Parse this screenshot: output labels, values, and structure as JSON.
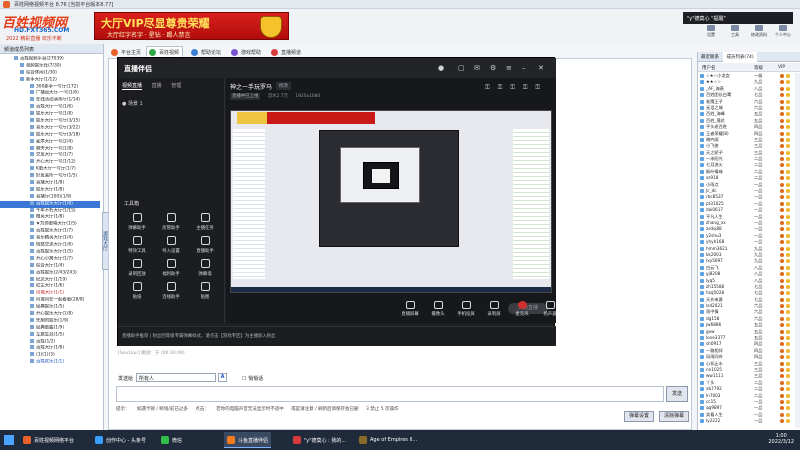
{
  "window": {
    "title": "百姓网络视频平台 8.76 [当前平台版本8.77]"
  },
  "banner": {
    "logo_main": "百姓视频网",
    "logo_url": "HD.FXT365.COM",
    "logo_slogan": "2022 精彩直播 欢乐不断",
    "vip_line1": "大厅VIP尽显尊贵荣耀",
    "vip_line2": "大厅红字名字 · 星钻 · 踢人禁言"
  },
  "tooltip": "\"y\"德莫心 \"提醒\"",
  "top_icons": [
    "设置",
    "工具",
    "修改资料",
    "个人中心"
  ],
  "left_panel": {
    "header": "频道成员列表",
    "tree": [
      {
        "label": "百姓视频平台(27039)",
        "cls": ""
      },
      {
        "label": "视频娱乐社(7/30)",
        "cls": ""
      },
      {
        "label": "综合休闲(1/30)",
        "cls": ""
      },
      {
        "label": "新手大厅(1/12)",
        "cls": ""
      },
      {
        "label": "300新手一号厅(172)",
        "cls": ""
      },
      {
        "label": "广播台大厅-一号(1/6)",
        "cls": ""
      },
      {
        "label": "在线活动演示厅(1/14)",
        "cls": ""
      },
      {
        "label": "百姓大厅一号(1/6)",
        "cls": ""
      },
      {
        "label": "娱乐大厅一号(1/8)",
        "cls": ""
      },
      {
        "label": "娱乐大厅一号厅(3/15)",
        "cls": ""
      },
      {
        "label": "音乐大厅一号厅(3/22)",
        "cls": ""
      },
      {
        "label": "娱乐大厅一号厅(3/18)",
        "cls": ""
      },
      {
        "label": "麦序大厅一号(2/4)",
        "cls": ""
      },
      {
        "label": "聊天大厅一号(1/8)",
        "cls": ""
      },
      {
        "label": "交友大厅一号(1/7)",
        "cls": ""
      },
      {
        "label": "开心大厅一号(1/12)",
        "cls": ""
      },
      {
        "label": "K歌大厅一号厅(1/7)",
        "cls": ""
      },
      {
        "label": "好友会所一号厅(1/5)",
        "cls": ""
      },
      {
        "label": "直播大厅(1/8)",
        "cls": ""
      },
      {
        "label": "娱乐大厅(1/8)",
        "cls": ""
      },
      {
        "label": "直播厅(100)(1/9)",
        "cls": ""
      },
      {
        "label": "百姓娱乐大厅(1/6)",
        "cls": "sel"
      },
      {
        "label": "千年不朽大厅(1/15)",
        "cls": ""
      },
      {
        "label": "精英大厅(1/8)",
        "cls": ""
      },
      {
        "label": "★为你歌唱大厅(1/5)",
        "cls": ""
      },
      {
        "label": "百姓娱乐大厅(1/7)",
        "cls": ""
      },
      {
        "label": "音乐精英大厅(1/4)",
        "cls": ""
      },
      {
        "label": "情感交流大厅(1/6)",
        "cls": ""
      },
      {
        "label": "百姓娱乐大厅(1/5)",
        "cls": ""
      },
      {
        "label": "开心小窝大厅(1/7)",
        "cls": ""
      },
      {
        "label": "综合大厅(1/4)",
        "cls": ""
      },
      {
        "label": "百姓娱乐(2/43/243)",
        "cls": ""
      },
      {
        "label": "纪念大厅(1/19)",
        "cls": ""
      },
      {
        "label": "红尘大厅(1/6)",
        "cls": ""
      },
      {
        "label": "同城大厅(1/1)",
        "cls": "red"
      },
      {
        "label": "同城同在一起看看(28/8)",
        "cls": ""
      },
      {
        "label": "经典娱乐(1/5)",
        "cls": ""
      },
      {
        "label": "开心娱乐大厅(1/8)",
        "cls": ""
      },
      {
        "label": "先期的娱乐(1/9)",
        "cls": ""
      },
      {
        "label": "经典歌曲(1/9)",
        "cls": ""
      },
      {
        "label": "军旅生涯(1/5)",
        "cls": ""
      },
      {
        "label": "百姓(1/2)",
        "cls": ""
      },
      {
        "label": "百姓大厅(1/6)",
        "cls": ""
      },
      {
        "label": "(1)(1)(3)",
        "cls": ""
      },
      {
        "label": "百姓欢乐(1/1)",
        "cls": "blu"
      }
    ],
    "vertical_tab": "游戏大厅"
  },
  "nav_tabs": [
    "平台主页",
    "百姓视频",
    "帮助论坛",
    "游戏帮助",
    "直播频道"
  ],
  "stream_app": {
    "logo": "直播伴侣",
    "tabs": [
      "视频直播",
      "直播",
      "管理"
    ],
    "scene": "● 场景 1",
    "room_title": "神之一手玩罗马",
    "room_badge": "修改",
    "room_sub": [
      "直播中已上线",
      "流水2.7万",
      "1920x1080"
    ],
    "tools_header": "工具箱",
    "tools": [
      "弹幕助手",
      "房管助手",
      "主播任务",
      "特效工具",
      "导入设置",
      "直播助手",
      "录制回放",
      "福利助手",
      "弹幕墙",
      "贴纸",
      "连线助手",
      "贴图"
    ],
    "bottom_tools": [
      "直播屏幕",
      "摄像头",
      "手机投屏",
      "录制屏",
      "麦克风",
      "扬声器"
    ],
    "start_live": "开始直播",
    "footer_notice": "直播助手推荐 | 粉丝团等级专属弹幕样式，请点击【游戏专区】为主播加入粉丝"
  },
  "chat": {
    "message_meta": "[Sou1kur] 踢进：于 (00:30:49)",
    "send_to_label": "发送给",
    "send_to_value": "所有人",
    "font_btn": "A",
    "private_chk": "悄悄话",
    "send_btn": "发送",
    "notice": [
      "提示：",
      "如遇卡顿 / 断线/前已过多",
      "点击：",
      "若你的电脑声音无法显示时不适中",
      "或是请注意 / 刷新后请保存会已删",
      "3 禁止 5 次操作"
    ],
    "btn_settings": "弹幕设置",
    "btn_clear": "清除弹幕"
  },
  "right_panel": {
    "tabs": [
      "最近联系",
      "成员列表(74)"
    ],
    "header": [
      "用户名",
      "等级",
      "VIP"
    ],
    "users": [
      {
        "name": "☆★☆小龙女",
        "rank": "一级"
      },
      {
        "name": "★★☆☆",
        "rank": "九品"
      },
      {
        "name": "_AF_海燕",
        "rank": "八品"
      },
      {
        "name": "百姓团长白鹭",
        "rank": "七品"
      },
      {
        "name": "老鹰王子",
        "rank": "六品"
      },
      {
        "name": "无泪之城",
        "rank": "六品"
      },
      {
        "name": "百姓_海峰",
        "rank": "五品"
      },
      {
        "name": "百姓_落花",
        "rank": "五品"
      },
      {
        "name": "平头老百姓",
        "rank": "四品"
      },
      {
        "name": "王者荣耀(8)",
        "rank": "四品"
      },
      {
        "name": "晓吟阁",
        "rank": "三品"
      },
      {
        "name": "小飞侠",
        "rank": "三品"
      },
      {
        "name": "天之骄子",
        "rank": "三品"
      },
      {
        "name": "一米阳光",
        "rank": "二品"
      },
      {
        "name": "七月流火",
        "rank": "二品"
      },
      {
        "name": "枫叶情缘",
        "rank": "二品"
      },
      {
        "name": "ss918",
        "rank": "二品"
      },
      {
        "name": "小雨点",
        "rank": "一品"
      },
      {
        "name": "Jc_dc",
        "rank": "一品"
      },
      {
        "name": "rbc8537",
        "rank": "一品"
      },
      {
        "name": "pt31025",
        "rank": "一品"
      },
      {
        "name": "dai0617",
        "rank": "一品"
      },
      {
        "name": "平凡人生",
        "rank": "一品"
      },
      {
        "name": "zhang_xx",
        "rank": "一品"
      },
      {
        "name": "zsdsj88",
        "rank": "一品"
      },
      {
        "name": "y2shu3",
        "rank": "一品"
      },
      {
        "name": "yhyh168",
        "rank": "一品"
      },
      {
        "name": "hmm3621",
        "rank": "九品"
      },
      {
        "name": "kk2003",
        "rank": "九品"
      },
      {
        "name": "Ixy5697",
        "rank": "九品"
      },
      {
        "name": "白云飞",
        "rank": "八品"
      },
      {
        "name": "yj8208",
        "rank": "八品"
      },
      {
        "name": "lyq5",
        "rank": "八品"
      },
      {
        "name": "zh15588",
        "rank": "七品"
      },
      {
        "name": "hzq5028",
        "rank": "七品"
      },
      {
        "name": "天外来客",
        "rank": "七品"
      },
      {
        "name": "lsd2021",
        "rank": "六品"
      },
      {
        "name": "雨中情",
        "rank": "六品"
      },
      {
        "name": "dg158",
        "rank": "六品"
      },
      {
        "name": "jw6886",
        "rank": "五品"
      },
      {
        "name": "gxw",
        "rank": "五品"
      },
      {
        "name": "love3377",
        "rank": "五品"
      },
      {
        "name": "sh0917",
        "rank": "四品"
      },
      {
        "name": "一路相伴",
        "rank": "四品"
      },
      {
        "name": "风雨同舟",
        "rank": "四品"
      },
      {
        "name": "心如止水",
        "rank": "三品"
      },
      {
        "name": "nn1025",
        "rank": "三品"
      },
      {
        "name": "ww1111",
        "rank": "三品"
      },
      {
        "name": "丫头",
        "rank": "二品"
      },
      {
        "name": "xb7792",
        "rank": "二品"
      },
      {
        "name": "ln7003",
        "rank": "二品"
      },
      {
        "name": "cc15",
        "rank": "一品"
      },
      {
        "name": "qq9897",
        "rank": "一品"
      },
      {
        "name": "笑看人生",
        "rank": "一品"
      },
      {
        "name": "ly2222",
        "rank": "一品"
      }
    ]
  },
  "taskbar": {
    "items": [
      {
        "label": "百姓视频网络平台",
        "color": "#e8612a"
      },
      {
        "label": "创作中心 - 头条号",
        "color": "#3aa0ff"
      },
      {
        "label": "微信",
        "color": "#2fbf4a"
      },
      {
        "label": "斗鱼直播伴侣",
        "color": "#f47b20"
      },
      {
        "label": "\"y\"德莫心 : 我的...",
        "color": "#d83b3b"
      },
      {
        "label": "Age of Empires II...",
        "color": "#8b6b2a"
      }
    ],
    "time": "1:00",
    "date": "2022/3/12"
  }
}
